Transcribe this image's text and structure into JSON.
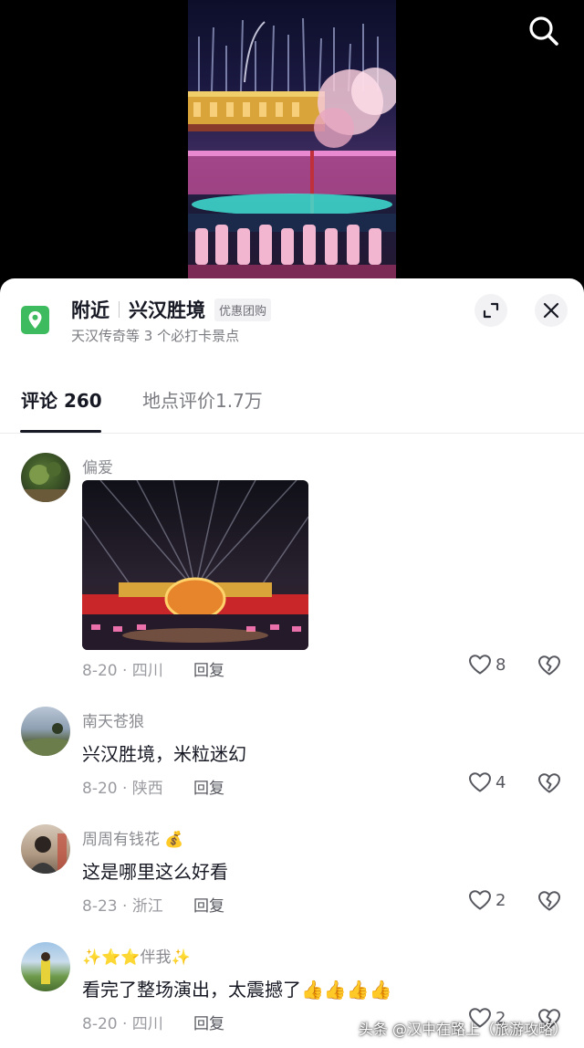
{
  "location": {
    "title_prefix": "附近",
    "title": "兴汉胜境",
    "tag": "优惠团购",
    "subtitle": "天汉传奇等 3 个必打卡景点"
  },
  "tabs": {
    "comments_label": "评论 260",
    "rating_label": "地点评价1.7万"
  },
  "comments": [
    {
      "user": "偏爱",
      "text": "",
      "date_region": "8-20 · 四川",
      "reply_label": "回复",
      "likes": "8",
      "has_photo": true
    },
    {
      "user": "南天苍狼",
      "text": "兴汉胜境，米粒迷幻",
      "date_region": "8-20 · 陕西",
      "reply_label": "回复",
      "likes": "4"
    },
    {
      "user": "周周有钱花 💰",
      "text": "这是哪里这么好看",
      "date_region": "8-23 · 浙江",
      "reply_label": "回复",
      "likes": "2"
    },
    {
      "user": "✨⭐⭐伴我✨",
      "text": "看完了整场演出，太震撼了👍👍👍👍",
      "date_region": "8-20 · 四川",
      "reply_label": "回复",
      "likes": "2"
    }
  ],
  "watermark": "头条 @汉中在路上（旅游攻略）",
  "icons": {
    "search": "search-icon",
    "pin": "map-pin-icon",
    "expand": "expand-icon",
    "close": "close-icon",
    "like": "heart-icon",
    "dislike": "broken-heart-icon"
  },
  "colors": {
    "pin_green": "#3dbb5e",
    "text_primary": "#161823",
    "text_secondary": "#8a8b90"
  }
}
